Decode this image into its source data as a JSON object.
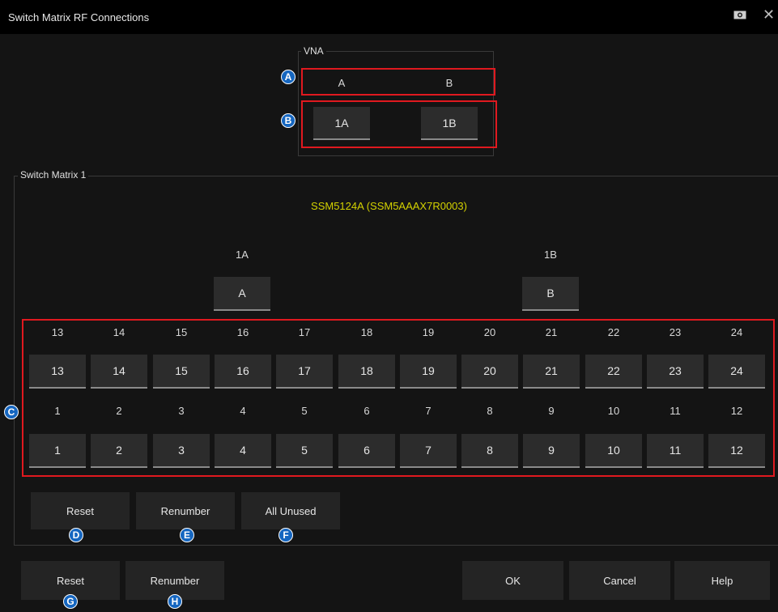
{
  "window": {
    "title": "Switch Matrix RF Connections",
    "camera_icon": "camera-icon",
    "close_icon": "close-icon"
  },
  "vna": {
    "legend": "VNA",
    "ports": [
      "A",
      "B"
    ],
    "buttons": [
      "1A",
      "1B"
    ]
  },
  "matrix": {
    "legend": "Switch Matrix 1",
    "device": "SSM5124A (SSM5AAAX7R0003)",
    "common": [
      {
        "label": "1A",
        "button": "A"
      },
      {
        "label": "1B",
        "button": "B"
      }
    ],
    "top_labels": [
      "13",
      "14",
      "15",
      "16",
      "17",
      "18",
      "19",
      "20",
      "21",
      "22",
      "23",
      "24"
    ],
    "top_buttons": [
      "13",
      "14",
      "15",
      "16",
      "17",
      "18",
      "19",
      "20",
      "21",
      "22",
      "23",
      "24"
    ],
    "bottom_labels": [
      "1",
      "2",
      "3",
      "4",
      "5",
      "6",
      "7",
      "8",
      "9",
      "10",
      "11",
      "12"
    ],
    "bottom_buttons": [
      "1",
      "2",
      "3",
      "4",
      "5",
      "6",
      "7",
      "8",
      "9",
      "10",
      "11",
      "12"
    ],
    "reset": "Reset",
    "renumber": "Renumber",
    "all_unused": "All Unused"
  },
  "footer": {
    "reset": "Reset",
    "renumber": "Renumber",
    "ok": "OK",
    "cancel": "Cancel",
    "help": "Help"
  },
  "callouts": [
    "A",
    "B",
    "C",
    "D",
    "E",
    "F",
    "G",
    "H"
  ],
  "colors": {
    "accent_red": "#e0191f",
    "callout_blue": "#1566c0",
    "device_yellow": "#d4d200"
  }
}
